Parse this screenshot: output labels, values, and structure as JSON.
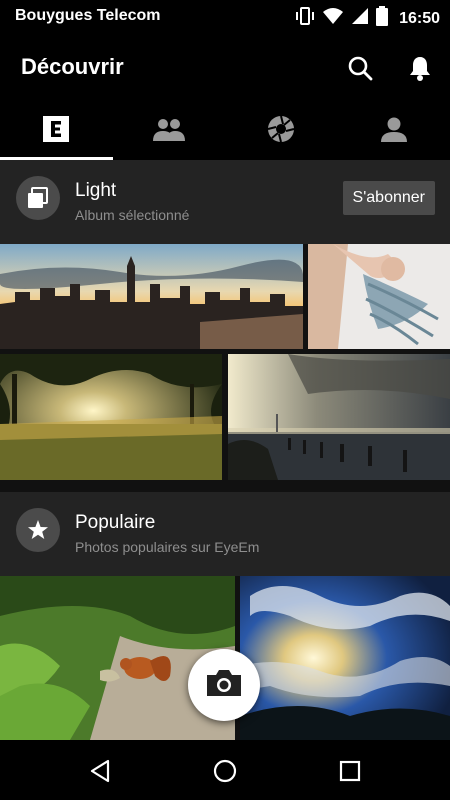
{
  "status_bar": {
    "carrier": "Bouygues Telecom",
    "time": "16:50",
    "icons": [
      "vibrate-icon",
      "wifi-icon",
      "cell-signal-icon",
      "battery-icon"
    ]
  },
  "app_bar": {
    "title": "Découvrir",
    "icons": [
      "search-icon",
      "bell-icon"
    ]
  },
  "tabs": [
    {
      "icon": "eyeem-logo-icon",
      "selected": true
    },
    {
      "icon": "people-icon",
      "selected": false
    },
    {
      "icon": "aperture-icon",
      "selected": false
    },
    {
      "icon": "person-icon",
      "selected": false
    }
  ],
  "sections": [
    {
      "icon": "album-stack-icon",
      "title": "Light",
      "subtitle": "Album sélectionné",
      "action_label": "S'abonner",
      "photos": [
        "city-skyline-sunset",
        "woman-hair-spread",
        "sunset-through-trees-field",
        "pier-sunset-sea"
      ]
    },
    {
      "icon": "star-icon",
      "title": "Populaire",
      "subtitle": "Photos populaires sur EyeEm",
      "photos": [
        "squirrel-in-grass",
        "dramatic-sky-clouds"
      ]
    }
  ],
  "fab": {
    "icon": "camera-icon"
  },
  "nav_bar": {
    "icons": [
      "back-icon",
      "home-icon",
      "recents-icon"
    ]
  },
  "colors": {
    "background": "#000000",
    "section_header": "#232323",
    "subscribe_button": "#4a4a4a",
    "subtitle": "#8e8e8e"
  }
}
